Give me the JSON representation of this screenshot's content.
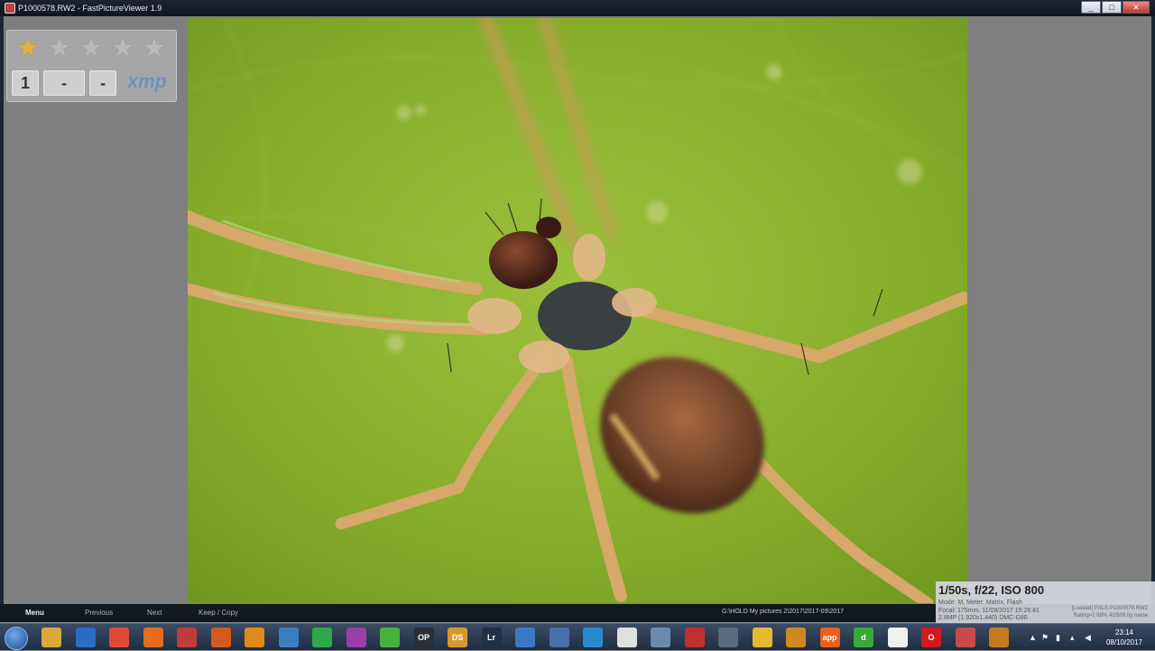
{
  "window": {
    "title": "P1000578.RW2 - FastPictureViewer 1.9",
    "controls": [
      "_",
      "□",
      "✕"
    ]
  },
  "rating_panel": {
    "stars_total": 5,
    "stars_filled": 1,
    "tag_number": "1",
    "tag_dash_1": "-",
    "tag_dash_2": "-",
    "tag_xmp": "xmp"
  },
  "bottom_bar": {
    "menu": "Menu",
    "previous": "Previous",
    "next": "Next",
    "keep_copy": "Keep / Copy",
    "path": "G:\\HOLD My pictures 2\\2017\\2017-09\\2017"
  },
  "exif": {
    "main": "1/50s, f/22, ISO 800",
    "mode_line": "Mode: M, Meter: Matrix, Flash",
    "focal_line": "Focal: 175mm, 11/09/2017 15:26:41",
    "size_line": "2.8MP (1,920x1,440) DMC-G80",
    "file_line": "[Loaded] PXLS P1000578.RW2",
    "status_line": "Rating=1  68%  41/509  by name"
  },
  "taskbar": {
    "icons": [
      {
        "name": "explorer-icon",
        "label": "",
        "color": "#d9a93a"
      },
      {
        "name": "outlook-icon",
        "label": "",
        "color": "#2b6cc4"
      },
      {
        "name": "chrome-icon",
        "label": "",
        "color": "#dd4b39"
      },
      {
        "name": "firefox-icon",
        "label": "",
        "color": "#e66a1f"
      },
      {
        "name": "app-icon-5",
        "label": "",
        "color": "#c23b3b"
      },
      {
        "name": "viewer-app-icon",
        "label": "",
        "color": "#d45a1a"
      },
      {
        "name": "gear-app-icon",
        "label": "",
        "color": "#e08a1c"
      },
      {
        "name": "app-icon-8",
        "label": "",
        "color": "#3a7ec2"
      },
      {
        "name": "app-icon-9",
        "label": "",
        "color": "#2fa84a"
      },
      {
        "name": "app-icon-10",
        "label": "",
        "color": "#9b3fa8"
      },
      {
        "name": "app-icon-11",
        "label": "",
        "color": "#46b23c"
      },
      {
        "name": "op-app-icon",
        "label": "OP",
        "color": "#2a2f38"
      },
      {
        "name": "ds-app-icon",
        "label": "DS",
        "color": "#d69a2c"
      },
      {
        "name": "lightroom-icon",
        "label": "Lr",
        "color": "#1f3048"
      },
      {
        "name": "app-icon-15",
        "label": "",
        "color": "#3c78c8"
      },
      {
        "name": "app-icon-16",
        "label": "",
        "color": "#4a6fa8"
      },
      {
        "name": "app-icon-17",
        "label": "",
        "color": "#2a8ad0"
      },
      {
        "name": "app-icon-18",
        "label": "",
        "color": "#e0e0e0"
      },
      {
        "name": "app-icon-19",
        "label": "",
        "color": "#6a8ab0"
      },
      {
        "name": "app-icon-20",
        "label": "",
        "color": "#c0302c"
      },
      {
        "name": "app-icon-21",
        "label": "",
        "color": "#5a6b80"
      },
      {
        "name": "app-icon-22",
        "label": "",
        "color": "#e8b830"
      },
      {
        "name": "app-icon-23",
        "label": "",
        "color": "#d08820"
      },
      {
        "name": "app-icon-24",
        "label": "app",
        "color": "#e86020"
      },
      {
        "name": "app-icon-25",
        "label": "d",
        "color": "#38a838"
      },
      {
        "name": "document-icon",
        "label": "",
        "color": "#f0f0f0"
      },
      {
        "name": "opera-icon",
        "label": "O",
        "color": "#d0181e"
      },
      {
        "name": "fastpictureviewer-icon",
        "label": "",
        "color": "#c84a4a"
      },
      {
        "name": "app-icon-29",
        "label": "",
        "color": "#c87820"
      }
    ],
    "tray_chevron": "▲",
    "clock_time": "23:14",
    "clock_date": "08/10/2017"
  }
}
